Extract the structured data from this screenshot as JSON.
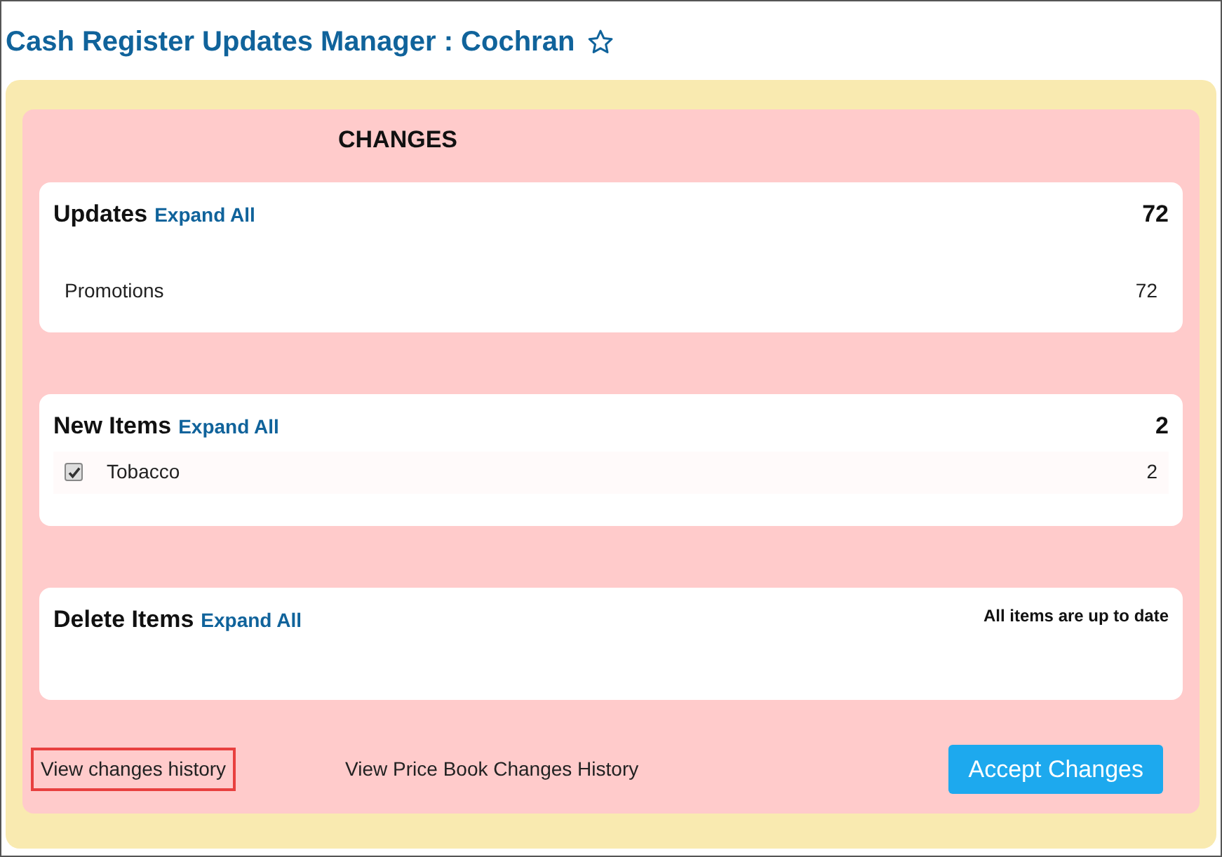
{
  "page_title": "Cash Register Updates Manager : Cochran",
  "favorite": false,
  "heading": "CHANGES",
  "sections": [
    {
      "title": "Updates",
      "expand_link": "Expand All",
      "total": "72",
      "rows": [
        {
          "kind": "plain",
          "label": "Promotions",
          "count": "72"
        }
      ]
    },
    {
      "title": "New Items",
      "expand_link": "Expand All",
      "total": "2",
      "rows": [
        {
          "kind": "checkbox",
          "label": "Tobacco",
          "count": "2",
          "checked": true
        }
      ]
    },
    {
      "title": "Delete Items",
      "expand_link": "Expand All",
      "message": "All items are up to date"
    }
  ],
  "footer_links": [
    {
      "label": "View changes history",
      "highlighted": true
    },
    {
      "label": "View Price Book Changes History",
      "highlighted": false
    }
  ],
  "accept_button": "Accept Changes"
}
